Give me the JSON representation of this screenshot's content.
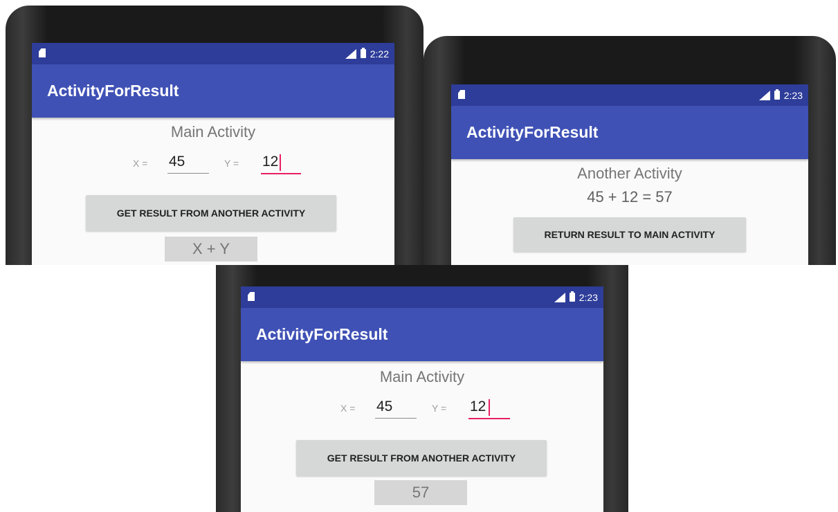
{
  "colors": {
    "status_bar": "#2e3d99",
    "app_bar": "#3f51b5",
    "accent": "#e91e63",
    "button_bg": "#d6d7d7",
    "screen_bg": "#fafafa"
  },
  "panels": [
    {
      "status": {
        "time": "2:22",
        "icons": [
          "sd-card-icon",
          "signal-icon",
          "battery-icon"
        ]
      },
      "app_title": "ActivityForResult",
      "heading": "Main Activity",
      "x_label": "X =",
      "x_value": "45",
      "y_label": "Y =",
      "y_value": "12",
      "button_label": "GET RESULT FROM ANOTHER ACTIVITY",
      "result_text": "X + Y"
    },
    {
      "status": {
        "time": "2:23",
        "icons": [
          "sd-card-icon",
          "signal-icon",
          "battery-icon"
        ]
      },
      "app_title": "ActivityForResult",
      "heading": "Another Activity",
      "result_line": "45 + 12 = 57",
      "button_label": "RETURN RESULT TO MAIN ACTIVITY"
    },
    {
      "status": {
        "time": "2:23",
        "icons": [
          "sd-card-icon",
          "signal-icon",
          "battery-icon"
        ]
      },
      "app_title": "ActivityForResult",
      "heading": "Main Activity",
      "x_label": "X =",
      "x_value": "45",
      "y_label": "Y =",
      "y_value": "12",
      "button_label": "GET RESULT FROM ANOTHER ACTIVITY",
      "result_text": "57"
    }
  ]
}
